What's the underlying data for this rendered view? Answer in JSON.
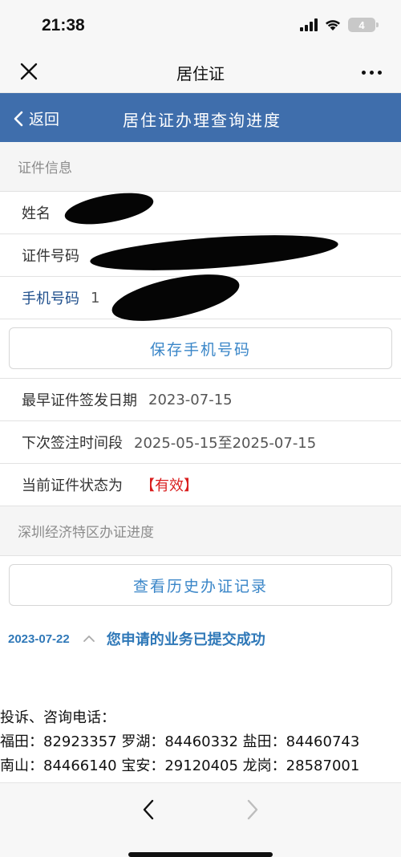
{
  "status_bar": {
    "time": "21:38",
    "battery": "4"
  },
  "webview_nav": {
    "title": "居住证"
  },
  "header": {
    "back_label": "返回",
    "title": "居住证办理查询进度"
  },
  "cert_info": {
    "section_title": "证件信息",
    "name_label": "姓名",
    "id_label": "证件号码",
    "phone_label": "手机号码",
    "phone_visible_prefix": "1",
    "save_phone_button": "保存手机号码",
    "issue_date_label": "最早证件签发日期",
    "issue_date_value": "2023-07-15",
    "next_sign_label": "下次签注时间段",
    "next_sign_value": "2025-05-15至2025-07-15",
    "status_label": "当前证件状态为",
    "status_value": "【有效】"
  },
  "progress": {
    "section_title": "深圳经济特区办证进度",
    "history_button": "查看历史办证记录",
    "date": "2023-07-22",
    "message": "您申请的业务已提交成功"
  },
  "contact": {
    "heading": "投诉、咨询电话：",
    "line1": "福田：82923357 罗湖：84460332 盐田：84460743",
    "line2": "南山：84466140 宝安：29120405 龙岗：28587001"
  },
  "colors": {
    "header_blue": "#3f6eac",
    "link_blue": "#3a86c8",
    "status_red": "#d91e1e"
  }
}
